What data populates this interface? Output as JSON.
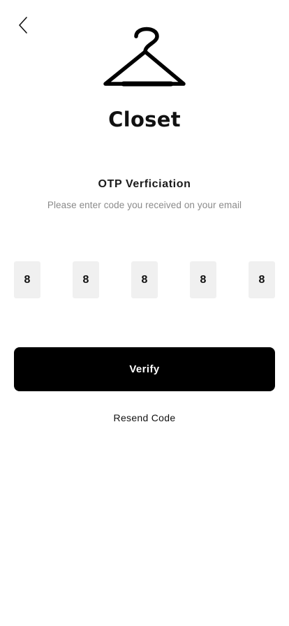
{
  "header": {
    "back_icon": "chevron-left-icon",
    "logo_icon": "clothes-hanger-icon"
  },
  "brand": {
    "title": "Closet"
  },
  "otp": {
    "heading": "OTP Verficiation",
    "subtitle": "Please enter code you received on your email",
    "digits": [
      "8",
      "8",
      "8",
      "8",
      "8"
    ]
  },
  "actions": {
    "verify_label": "Verify",
    "resend_label": "Resend Code"
  },
  "colors": {
    "primary": "#000000",
    "background": "#ffffff",
    "input_background": "#f0f0f0",
    "subtitle_text": "#8a8a8a"
  }
}
